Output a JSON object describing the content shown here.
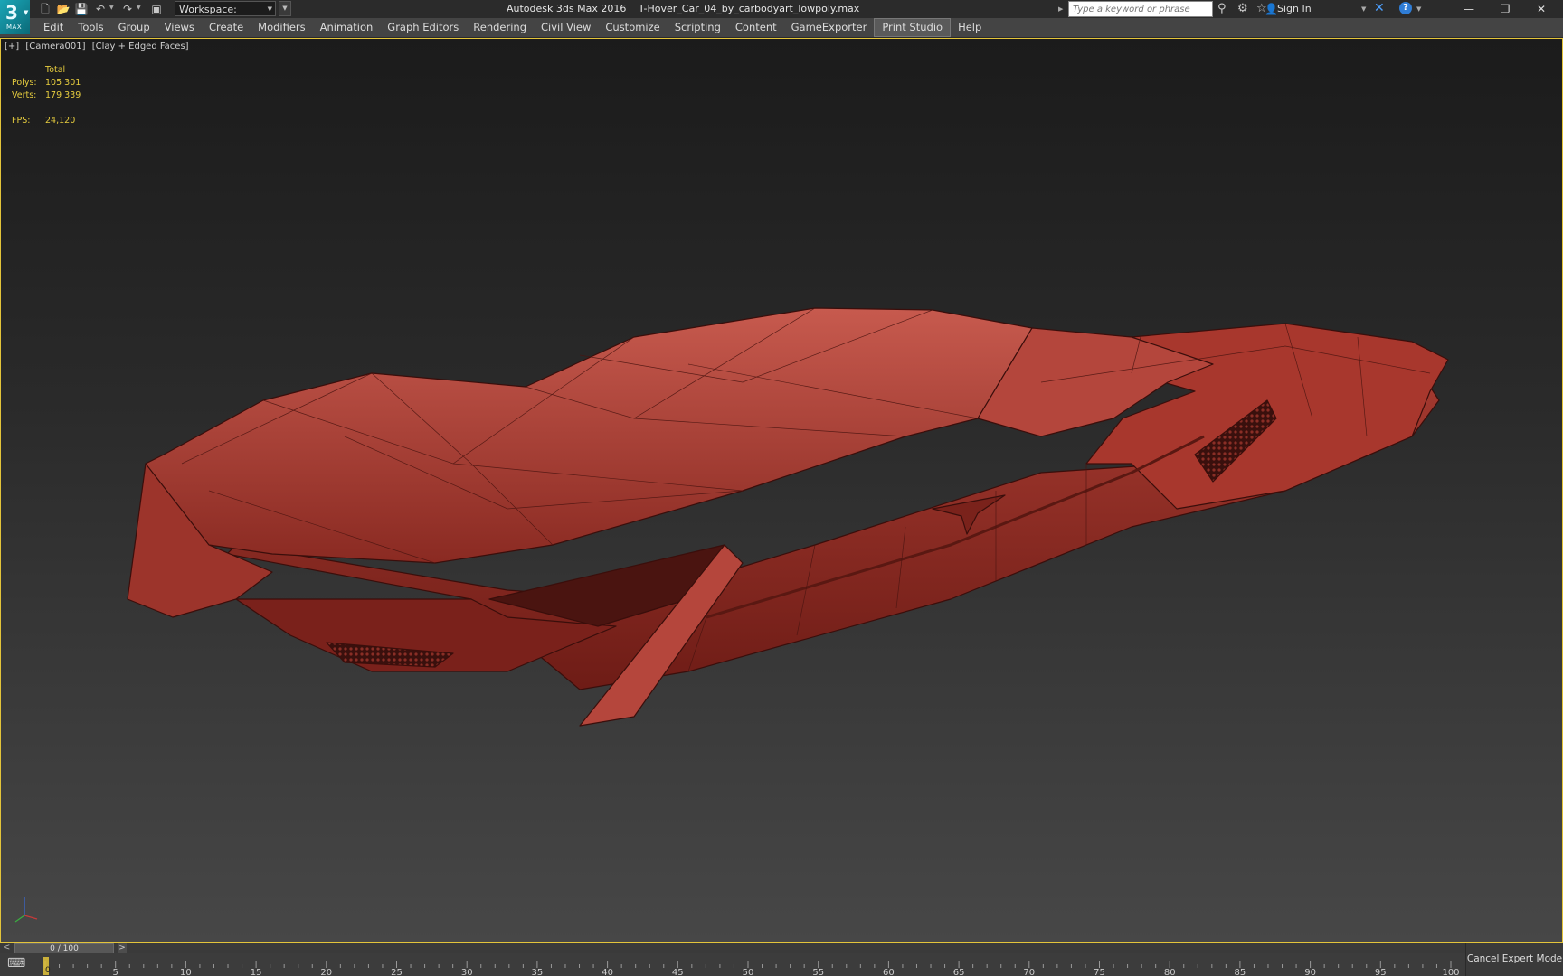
{
  "app": {
    "logo_label": "MAX",
    "title": "Autodesk 3ds Max 2016",
    "file": "T-Hover_Car_04_by_carbodyart_lowpoly.max"
  },
  "quick_access": {
    "icons": [
      "new-file-icon",
      "open-folder-icon",
      "save-icon",
      "undo-icon",
      "redo-icon",
      "project-folder-icon"
    ],
    "workspace_label": "Workspace: Default"
  },
  "infocenter": {
    "search_placeholder": "Type a keyword or phrase",
    "sign_in": "Sign In"
  },
  "menu": {
    "items": [
      "Edit",
      "Tools",
      "Group",
      "Views",
      "Create",
      "Modifiers",
      "Animation",
      "Graph Editors",
      "Rendering",
      "Civil View",
      "Customize",
      "Scripting",
      "Content",
      "GameExporter",
      "Print Studio",
      "Help"
    ],
    "active": "Print Studio"
  },
  "viewport": {
    "label_plus": "[+]",
    "label_camera": "[Camera001]",
    "label_shading": "[Clay + Edged Faces]",
    "border_color": "#e3c43a",
    "model_color": "#b5463c",
    "stats": {
      "header": "Total",
      "polys_label": "Polys:",
      "polys_value": "105 301",
      "verts_label": "Verts:",
      "verts_value": "179 339",
      "fps_label": "FPS:",
      "fps_value": "24,120",
      "color": "#e6cc3e"
    }
  },
  "timeline": {
    "slider_label": "0 / 100",
    "prev": "<",
    "next": ">",
    "start": 0,
    "end": 100,
    "major_every": 5,
    "current_frame": 0
  },
  "status": {
    "cancel_expert": "Cancel Expert Mode"
  }
}
